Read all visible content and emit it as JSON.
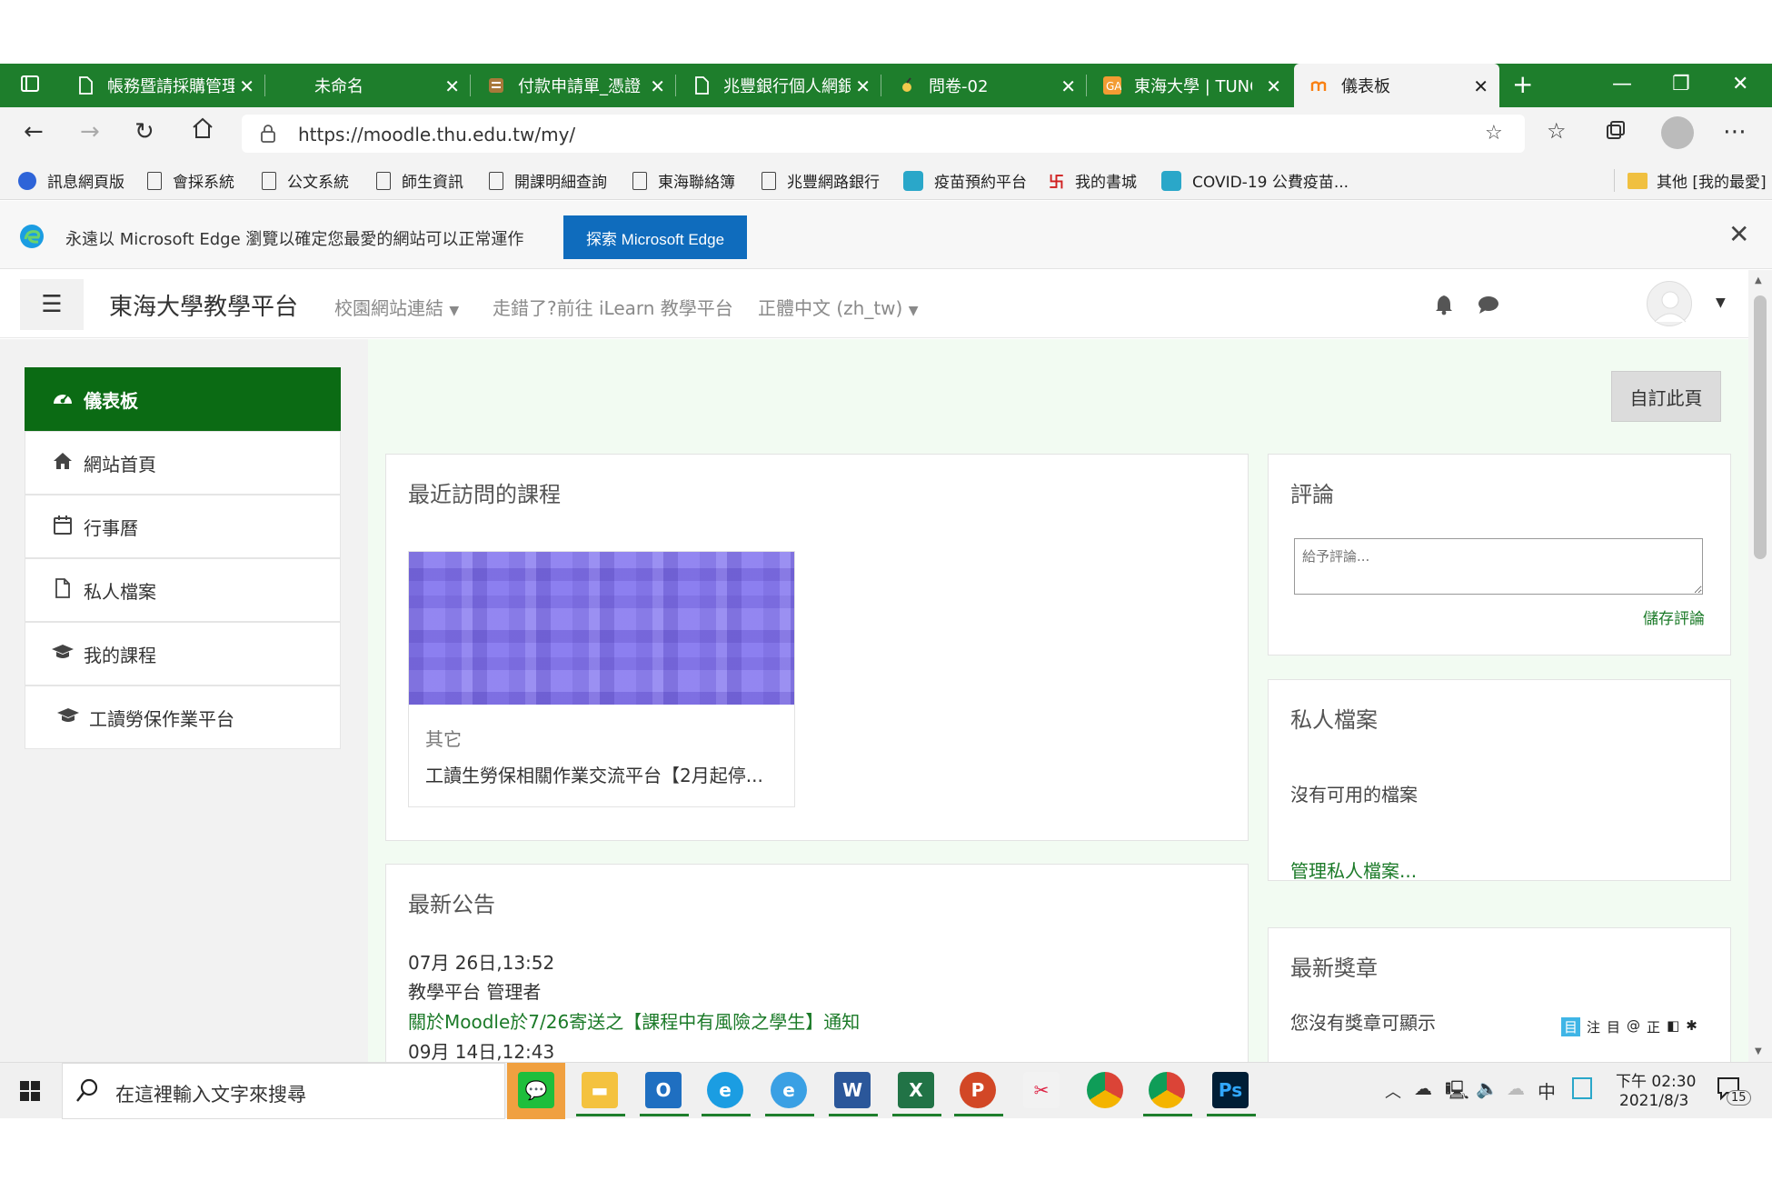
{
  "browser": {
    "tabs": [
      {
        "title": "帳務暨請採購管理"
      },
      {
        "title": "未命名"
      },
      {
        "title": "付款申請單_憑證"
      },
      {
        "title": "兆豐銀行個人網銀"
      },
      {
        "title": "問卷-02"
      },
      {
        "title": "東海大學 | TUNGHAI"
      },
      {
        "title": "儀表板"
      }
    ],
    "url": "https://moodle.thu.edu.tw/my/",
    "bookmarks": [
      "訊息網頁版",
      "會採系統",
      "公文系統",
      "師生資訊",
      "開課明細查詢",
      "東海聯絡簿",
      "兆豐網路銀行",
      "疫苗預約平台",
      "我的書城",
      "COVID-19 公費疫苗..."
    ],
    "other_bookmarks": "其他 [我的最愛]"
  },
  "banner": {
    "text": "永遠以 Microsoft Edge 瀏覽以確定您最愛的網站可以正常運作",
    "button": "探索 Microsoft Edge"
  },
  "navbar": {
    "site_name": "東海大學教學平台",
    "links": [
      "校園網站連結",
      "走錯了?前往 iLearn 教學平台",
      "正體中文 (zh_tw)"
    ]
  },
  "sidebar": {
    "items": [
      {
        "label": "儀表板",
        "icon": "dashboard-icon"
      },
      {
        "label": "網站首頁",
        "icon": "home-icon"
      },
      {
        "label": "行事曆",
        "icon": "calendar-icon"
      },
      {
        "label": "私人檔案",
        "icon": "file-icon"
      },
      {
        "label": "我的課程",
        "icon": "graduation-cap-icon"
      },
      {
        "label": "工讀勞保作業平台",
        "icon": "graduation-cap-icon"
      }
    ]
  },
  "main": {
    "customise_button": "自訂此頁",
    "recent_courses": {
      "title": "最近訪問的課程",
      "course_category": "其它",
      "course_name": "工讀生勞保相關作業交流平台【2月起停..."
    },
    "announcements": {
      "title": "最新公告",
      "items": [
        {
          "date": "07月 26日,13:52",
          "author": "教學平台 管理者",
          "subject": "關於Moodle於7/26寄送之【課程中有風險之學生】通知"
        },
        {
          "date": "09月 14日,12:43"
        }
      ]
    }
  },
  "right": {
    "comments": {
      "title": "評論",
      "placeholder": "給予評論...",
      "save": "儲存評論"
    },
    "private_files": {
      "title": "私人檔案",
      "empty": "沒有可用的檔案",
      "manage": "管理私人檔案..."
    },
    "badges": {
      "title": "最新獎章",
      "empty": "您沒有獎章可顯示"
    }
  },
  "taskbar": {
    "search_placeholder": "在這裡輸入文字來搜尋",
    "time": "下午 02:30",
    "date": "2021/8/3",
    "notifications": "15",
    "ime": [
      "目",
      "注",
      "目",
      "@",
      "正",
      "◧",
      "✱"
    ],
    "ime_lang": "中"
  },
  "colors": {
    "tabbar": "#1e7e2c",
    "sidebar_active": "#0b6b14",
    "link_green": "#1b7a28",
    "edge_blue": "#0f6cbd"
  }
}
